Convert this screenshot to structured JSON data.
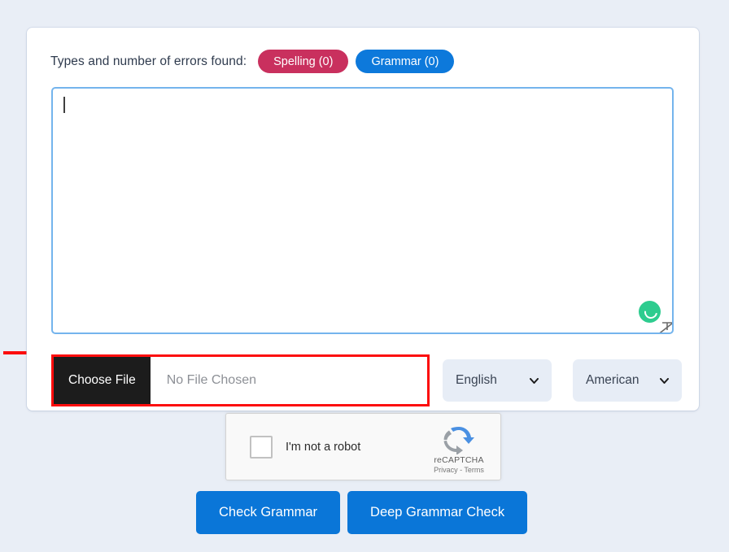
{
  "page": {
    "background_color": "#e9eef6",
    "card_background": "#ffffff"
  },
  "errors_summary": {
    "label": "Types and number of errors found:",
    "badges": [
      {
        "label": "Spelling (0)",
        "color": "#c9305e",
        "name": "spelling"
      },
      {
        "label": "Grammar (0)",
        "color": "#0d79db",
        "name": "grammar"
      }
    ]
  },
  "editor": {
    "value": "",
    "placeholder": "",
    "focused": true,
    "border_color": "#74b4ed",
    "status_icon": "loading-spinner-icon",
    "status_color": "#2ecc8f",
    "resize_icon": "resize-handle-icon"
  },
  "file_upload": {
    "button_label": "Choose File",
    "file_name": "No File Chosen",
    "highlight_color": "#fc0d0d",
    "button_background": "#1c1c1c"
  },
  "language_select": {
    "value": "English",
    "icon": "chevron-down-icon"
  },
  "variant_select": {
    "value": "American",
    "icon": "chevron-down-icon"
  },
  "annotation": {
    "arrow_icon": "red-arrow-right-icon",
    "arrow_color": "#fc0d0d"
  },
  "recaptcha": {
    "checkbox_label": "I'm not a robot",
    "checked": false,
    "brand": "reCAPTCHA",
    "links": "Privacy - Terms",
    "logo_icon": "recaptcha-logo-icon"
  },
  "actions": {
    "buttons": [
      {
        "label": "Check Grammar",
        "name": "check-grammar"
      },
      {
        "label": "Deep Grammar Check",
        "name": "deep-grammar-check"
      }
    ],
    "color": "#0a76d8"
  }
}
